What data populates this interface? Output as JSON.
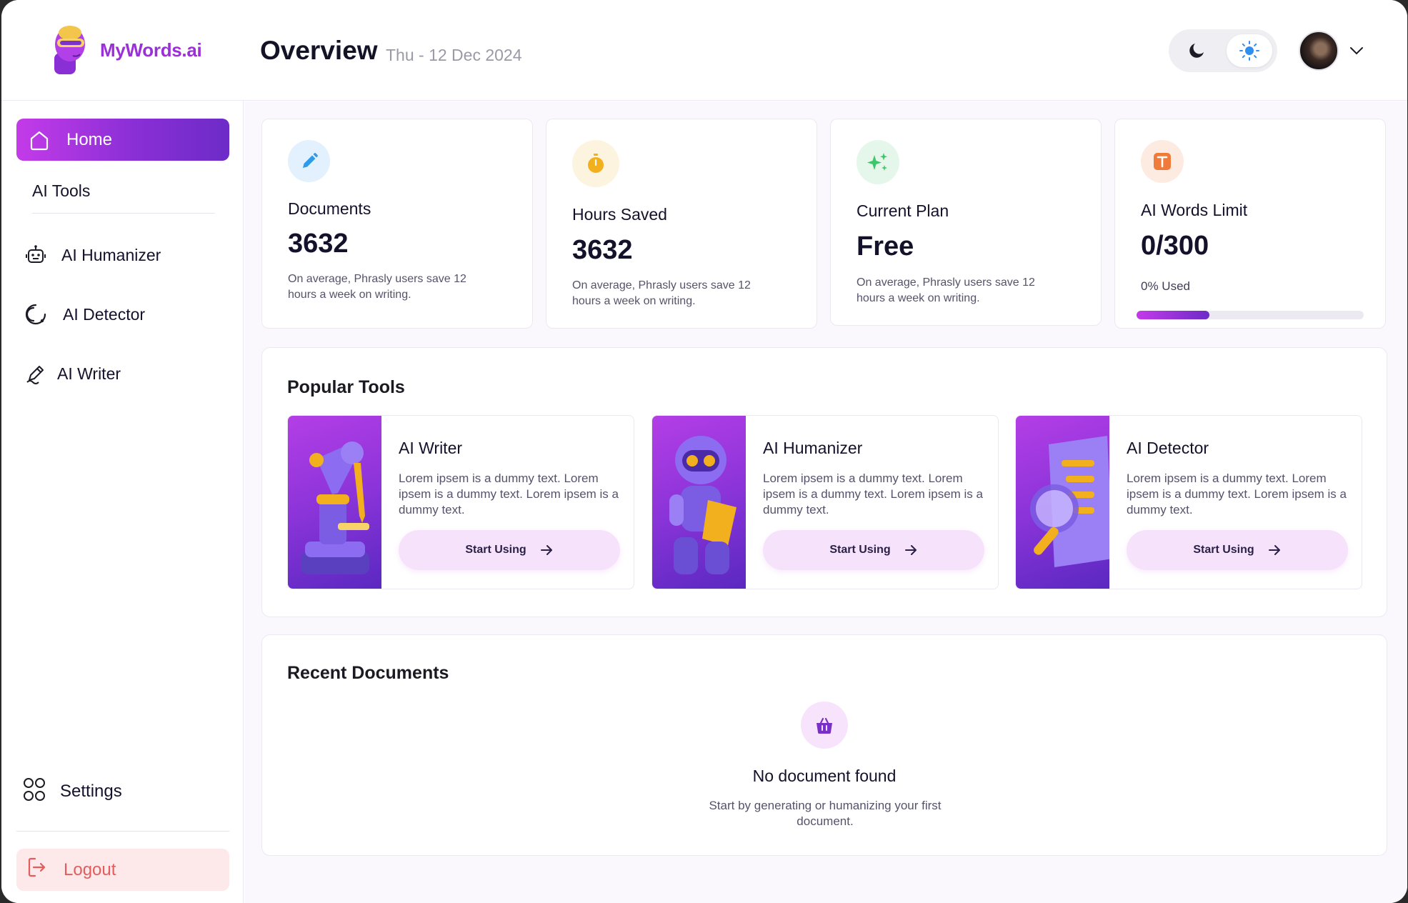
{
  "brand": {
    "name": "MyWords.ai"
  },
  "header": {
    "title": "Overview",
    "date": "Thu - 12 Dec 2024",
    "theme_toggle": {
      "options": [
        "dark-mode",
        "light-mode"
      ],
      "selected": "light-mode"
    }
  },
  "sidebar": {
    "home": "Home",
    "section_label": "AI Tools",
    "items": [
      {
        "label": "AI Humanizer",
        "icon": "robot-icon"
      },
      {
        "label": "AI Detector",
        "icon": "detector-icon"
      },
      {
        "label": "AI Writer",
        "icon": "pen-icon"
      }
    ],
    "settings": "Settings",
    "logout": "Logout"
  },
  "stats": [
    {
      "label": "Documents",
      "value": "3632",
      "desc": "On average, Phrasly users save 12 hours a week on writing.",
      "icon": "pencil-icon",
      "accent": "#2f9be8"
    },
    {
      "label": "Hours Saved",
      "value": "3632",
      "desc": "On average, Phrasly users save 12 hours a week on writing.",
      "icon": "stopwatch-icon",
      "accent": "#f2b01e"
    },
    {
      "label": "Current Plan",
      "value": "Free",
      "desc": "On average, Phrasly users save 12 hours a week on writing.",
      "icon": "sparkles-icon",
      "accent": "#3cc76a"
    },
    {
      "label": "AI Words Limit",
      "value": "0/300",
      "usage": "0% Used",
      "progress": 0.32,
      "icon": "text-icon",
      "accent": "#f07a3a"
    }
  ],
  "popular_tools": {
    "title": "Popular Tools",
    "tools": [
      {
        "title": "AI Writer",
        "desc": "Lorem ipsem is a dummy text. Lorem ipsem is a dummy text. Lorem ipsem is a dummy text.",
        "button": "Start Using"
      },
      {
        "title": "AI Humanizer",
        "desc": "Lorem ipsem is a dummy text. Lorem ipsem is a dummy text. Lorem ipsem is a dummy text.",
        "button": "Start Using"
      },
      {
        "title": "AI Detector",
        "desc": "Lorem ipsem is a dummy text. Lorem ipsem is a dummy text. Lorem ipsem is a dummy text.",
        "button": "Start Using"
      }
    ]
  },
  "recent_documents": {
    "title": "Recent Documents",
    "empty_title": "No document found",
    "empty_desc": "Start by generating or humanizing your first document."
  },
  "colors": {
    "brand_gradient_start": "#c43be9",
    "brand_gradient_end": "#6d2bc7",
    "logout_bg": "#fde8ea",
    "logout_text": "#e35d5d"
  }
}
